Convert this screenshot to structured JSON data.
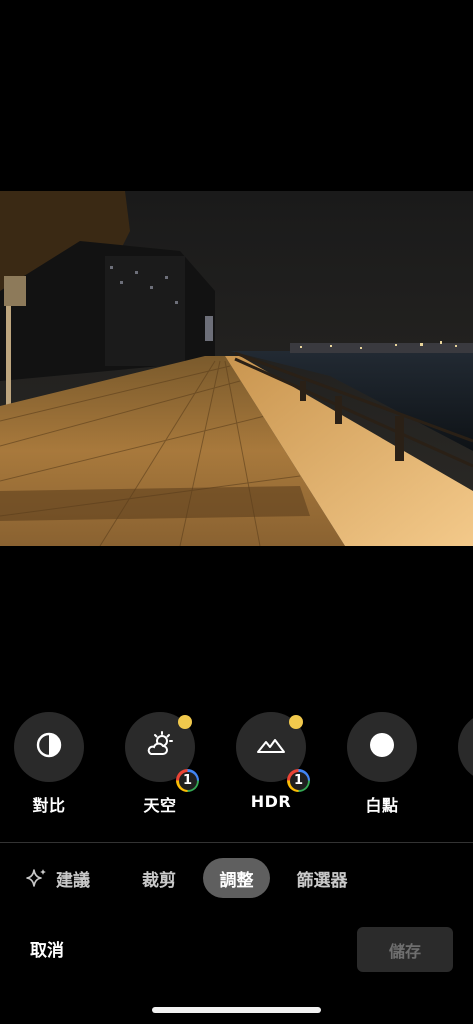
{
  "tools": [
    {
      "label": "對比",
      "icon": "contrast-icon",
      "has_dot": false,
      "badge": ""
    },
    {
      "label": "天空",
      "icon": "sky-weather-icon",
      "has_dot": true,
      "badge": "1"
    },
    {
      "label": "HDR",
      "icon": "hdr-mountain-icon",
      "has_dot": true,
      "badge": "1"
    },
    {
      "label": "白點",
      "icon": "white-point-icon",
      "has_dot": false,
      "badge": ""
    }
  ],
  "tabs": [
    {
      "label": "建議",
      "icon": "sparkle-icon",
      "active": false
    },
    {
      "label": "裁剪",
      "active": false
    },
    {
      "label": "調整",
      "active": true
    },
    {
      "label": "篩選器",
      "active": false
    }
  ],
  "actions": {
    "cancel_label": "取消",
    "save_label": "儲存"
  },
  "colors": {
    "background": "#000000",
    "tool_circle": "#2a2a2a",
    "indicator_dot": "#f1c94d",
    "active_tab": "#5f5f5f",
    "save_button_bg": "#2b2b2b",
    "save_button_text": "#6f6f6f"
  }
}
